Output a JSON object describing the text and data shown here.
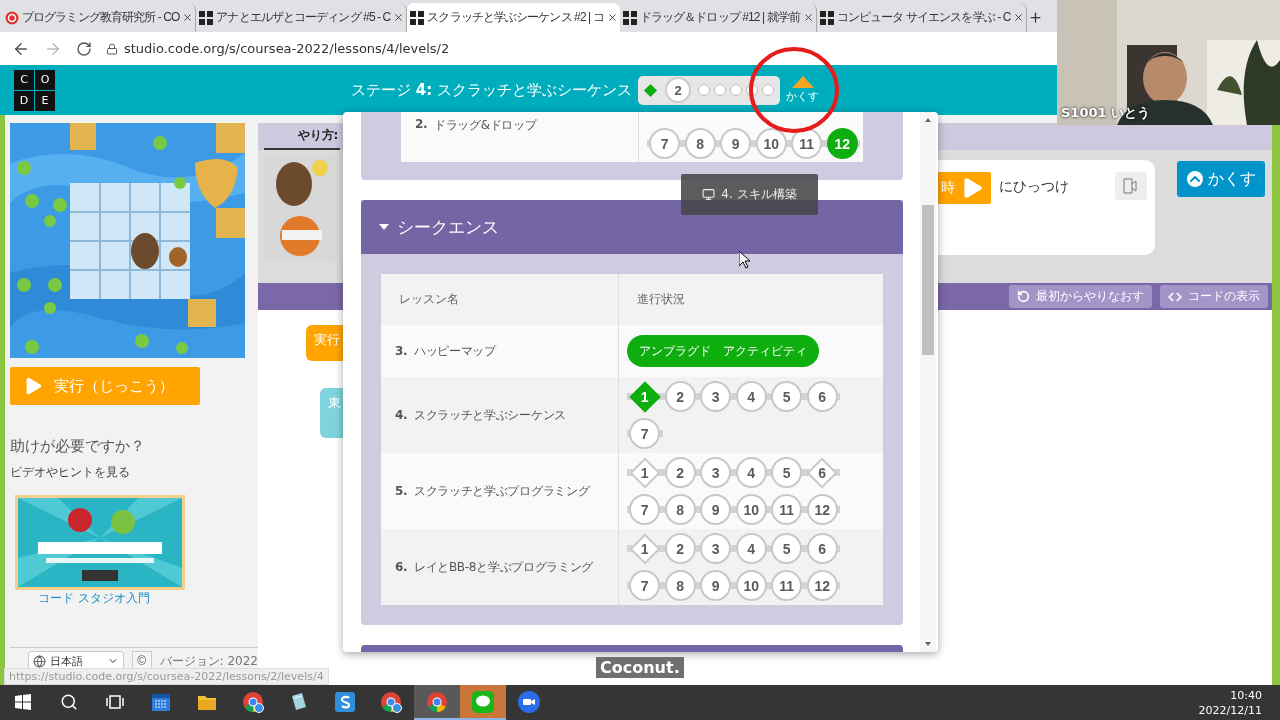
{
  "browser": {
    "tabs": [
      {
        "title": "プログラミング教育研究所 - CO",
        "kind": "org",
        "selected": false
      },
      {
        "title": "アナとエルザとコーディング #5 - C",
        "kind": "code",
        "selected": false
      },
      {
        "title": "スクラッチと学ぶシーケンス #2 | コ",
        "kind": "code",
        "selected": true
      },
      {
        "title": "ドラッグ＆ドロップ #12 | 就学前",
        "kind": "code",
        "selected": false
      },
      {
        "title": "コンピュータ サイエンスを学ぶ - C",
        "kind": "code",
        "selected": false
      }
    ],
    "url": "studio.code.org/s/coursea-2022/lessons/4/levels/2"
  },
  "header": {
    "logo": [
      "C",
      "O",
      "D",
      "E"
    ],
    "title": "ステージ **4:** スクラッチと学ぶシーケンス",
    "progress": [
      {
        "kind": "diamond",
        "completed": true
      },
      {
        "kind": "bubble",
        "label": "2"
      },
      {
        "kind": "dot"
      },
      {
        "kind": "dot"
      },
      {
        "kind": "dot"
      },
      {
        "kind": "dot"
      },
      {
        "kind": "dot"
      }
    ],
    "toggle": "かくす"
  },
  "sidebar": {
    "run_button": "実行（じっこう）",
    "help_title": "助けが必要ですか？",
    "help_subtitle": "ビデオやヒントを見る",
    "video": {
      "kind": "picture",
      "link": "コード スタジオ入門"
    },
    "language": "日本語",
    "copyright": "©",
    "version": "バージョン: 2022"
  },
  "instructions": {
    "tab": "やり方:",
    "block": "時",
    "text": "にひっつけ",
    "hide_button": "かくす"
  },
  "workspace": {
    "toolbar": [
      {
        "kind": "reset",
        "label": "最初からやりなおす"
      },
      {
        "kind": "code",
        "label": "コードの表示"
      }
    ],
    "blocks": [
      {
        "kind": "event",
        "label": "実行"
      },
      {
        "kind": "move",
        "label": "東"
      }
    ]
  },
  "lesson_popup": {
    "tooltip": "4. スキル構築",
    "sections": [
      {
        "lessons": [
          {
            "name": "**2.** ドラッグ&ドロップ",
            "kind": "levels",
            "levels": [
              {
                "label": "7",
                "kind": "circle",
                "completed": false
              },
              {
                "label": "8",
                "kind": "circle",
                "completed": false
              },
              {
                "label": "9",
                "kind": "circle",
                "completed": false
              },
              {
                "label": "10",
                "kind": "circle",
                "completed": false
              },
              {
                "label": "11",
                "kind": "circle",
                "completed": false
              },
              {
                "label": "12",
                "kind": "circle",
                "completed": true
              }
            ]
          }
        ]
      },
      {
        "title": "シークエンス",
        "expanded": true,
        "columns": [
          "レッスン名",
          "進行状況"
        ],
        "lessons": [
          {
            "name": "**3.** ハッピーマップ",
            "kind": "activity",
            "activity": "アンプラグド　アクティビティ",
            "completed": true
          },
          {
            "name": "**4.** スクラッチと学ぶシーケンス",
            "kind": "levels",
            "levels": [
              {
                "label": "1",
                "kind": "diamond",
                "completed": true
              },
              {
                "label": "2",
                "kind": "circle",
                "completed": false
              },
              {
                "label": "3",
                "kind": "circle",
                "completed": false
              },
              {
                "label": "4",
                "kind": "circle",
                "completed": false
              },
              {
                "label": "5",
                "kind": "circle",
                "completed": false
              },
              {
                "label": "6",
                "kind": "circle",
                "completed": false
              },
              {
                "label": "7",
                "kind": "circle",
                "completed": false
              }
            ]
          },
          {
            "name": "**5.** スクラッチと学ぶプログラミング",
            "kind": "levels",
            "levels": [
              {
                "label": "1",
                "kind": "diamond",
                "completed": false
              },
              {
                "label": "2",
                "kind": "circle",
                "completed": false
              },
              {
                "label": "3",
                "kind": "circle",
                "completed": false
              },
              {
                "label": "4",
                "kind": "circle",
                "completed": false
              },
              {
                "label": "5",
                "kind": "circle",
                "completed": false
              },
              {
                "label": "6",
                "kind": "diamond",
                "completed": false
              },
              {
                "label": "7",
                "kind": "circle",
                "completed": false
              },
              {
                "label": "8",
                "kind": "circle",
                "completed": false
              },
              {
                "label": "9",
                "kind": "circle",
                "completed": false
              },
              {
                "label": "10",
                "kind": "circle",
                "completed": false
              },
              {
                "label": "11",
                "kind": "circle",
                "completed": false
              },
              {
                "label": "12",
                "kind": "circle",
                "completed": false
              }
            ]
          },
          {
            "name": "**6.** レイとBB-8と学ぶプログラミング",
            "kind": "levels",
            "levels": [
              {
                "label": "1",
                "kind": "diamond",
                "completed": false
              },
              {
                "label": "2",
                "kind": "circle",
                "completed": false
              },
              {
                "label": "3",
                "kind": "circle",
                "completed": false
              },
              {
                "label": "4",
                "kind": "circle",
                "completed": false
              },
              {
                "label": "5",
                "kind": "circle",
                "completed": false
              },
              {
                "label": "6",
                "kind": "circle",
                "completed": false
              },
              {
                "label": "7",
                "kind": "circle",
                "completed": false
              },
              {
                "label": "8",
                "kind": "circle",
                "completed": false
              },
              {
                "label": "9",
                "kind": "circle",
                "completed": false
              },
              {
                "label": "10",
                "kind": "circle",
                "completed": false
              },
              {
                "label": "11",
                "kind": "circle",
                "completed": false
              },
              {
                "label": "12",
                "kind": "circle",
                "completed": false
              }
            ]
          }
        ]
      }
    ]
  },
  "status_url": "https://studio.code.org/s/coursea-2022/lessons/2/levels/4",
  "video_call": {
    "name": "S1001 いとう",
    "caption": "Coconut."
  },
  "taskbar": {
    "buttons": [
      {
        "kind": "start"
      },
      {
        "kind": "search"
      },
      {
        "kind": "taskview"
      }
    ],
    "apps": [
      {
        "kind": "calendar",
        "selected": false,
        "attention": false
      },
      {
        "kind": "folder",
        "selected": false,
        "attention": false
      },
      {
        "kind": "chrome_badge",
        "selected": false,
        "attention": false
      },
      {
        "kind": "notes",
        "selected": false,
        "attention": false
      },
      {
        "kind": "s_app",
        "selected": false,
        "attention": false
      },
      {
        "kind": "chrome_badge",
        "selected": false,
        "attention": false
      },
      {
        "kind": "chrome",
        "selected": true,
        "attention": false
      },
      {
        "kind": "line",
        "selected": false,
        "attention": true
      },
      {
        "kind": "zoom",
        "selected": false,
        "attention": false
      }
    ],
    "time": "10:40",
    "date": "2022/12/11"
  }
}
